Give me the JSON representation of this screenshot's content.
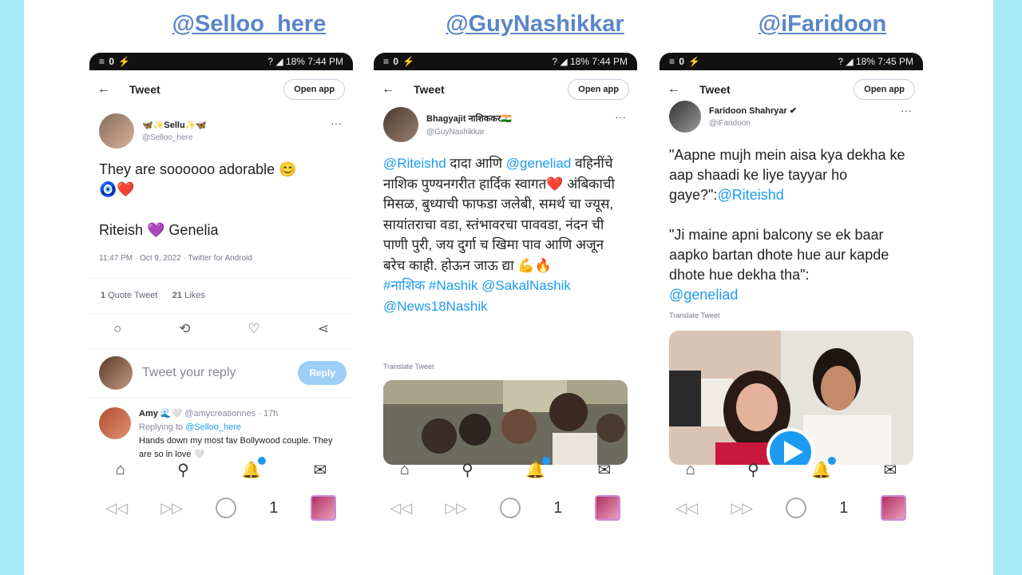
{
  "handles": [
    "@Selloo_here",
    "@GuyNashikkar",
    "@iFaridoon"
  ],
  "phones": [
    {
      "status_left": "≡ 0 ⚡",
      "status_right": "? ◢ 18% 7:44 PM",
      "header": {
        "back": "←",
        "title": "Tweet",
        "open_app": "Open app"
      },
      "author_name": "🦋✨Sellu✨🦋",
      "author_handle": "@Selloo_here",
      "text1": "They are soooooo adorable 😊",
      "text2": "🧿❤️",
      "text3": "Riteish 💜 Genelia",
      "timestamp": "11:47 PM · Oct 9, 2022 · Twitter for Android",
      "quote_count": "1",
      "quote_label": "Quote Tweet",
      "like_count": "21",
      "like_label": "Likes",
      "reply_placeholder": "Tweet your reply",
      "reply_button": "Reply",
      "reply_author": "Amy 🌊🤍",
      "reply_handle": "@amycreationnes · 17h",
      "reply_to": "Replying to",
      "reply_to_handle": "@Selloo_here",
      "reply_text": "Hands down my most fav Bollywood couple. They are so in love 🤍",
      "tab_count": "1"
    },
    {
      "status_left": "≡ 0 ⚡",
      "status_right": "? ◢ 18% 7:44 PM",
      "header": {
        "back": "←",
        "title": "Tweet",
        "open_app": "Open app"
      },
      "author_name": "Bhagyajit नाशिककर🇮🇳",
      "author_handle": "@GuyNashikkar",
      "mention1": "@Riteishd",
      "text_a": " दादा आणि ",
      "mention2": "@geneliad",
      "text_b": "वहिनींचे नाशिक पुण्यनगरीत हार्दिक स्वागत❤️ अंबिकाची मिसळ, बुध्याची फाफडा जलेबी, समर्थ चा ज्यूस, सायांतराचा वडा, स्तंभावरचा पाववडा, नंदन ची पाणी पुरी, जय दुर्गा च खिमा पाव आणि अजून बरेच काही. होऊन जाऊ द्या 💪🔥",
      "tags": "#नाशिक #Nashik @SakalNashik @News18Nashik",
      "translate": "Translate Tweet",
      "tab_count": "1"
    },
    {
      "status_left": "≡ 0 ⚡",
      "status_right": "? ◢ 18% 7:45 PM",
      "header": {
        "back": "←",
        "title": "Tweet",
        "open_app": "Open app"
      },
      "author_name": "Faridoon Shahryar ✔",
      "author_handle": "@iFaridoon",
      "quote1": "\"Aapne mujh mein aisa kya dekha ke aap shaadi ke liye tayyar ho gaye?\":",
      "quote1_mention": "@Riteishd",
      "quote2": "\"Ji maine apni balcony se ek baar aapko bartan dhote hue aur kapde dhote hue dekha tha\":",
      "quote2_mention": "@geneliad",
      "translate": "Translate Tweet",
      "tab_count": "1"
    }
  ],
  "icons": {
    "home": "⌂",
    "search": "⚲",
    "bell": "🔔",
    "mail": "✉",
    "back": "◁◁",
    "fwd": "▷▷",
    "comment": "💬",
    "retweet": "⟲",
    "like": "♡",
    "share": "⋖"
  },
  "colors": {
    "accent": "#1d9bf0",
    "handle": "#5a86c8",
    "bg": "#a6eaf6"
  }
}
